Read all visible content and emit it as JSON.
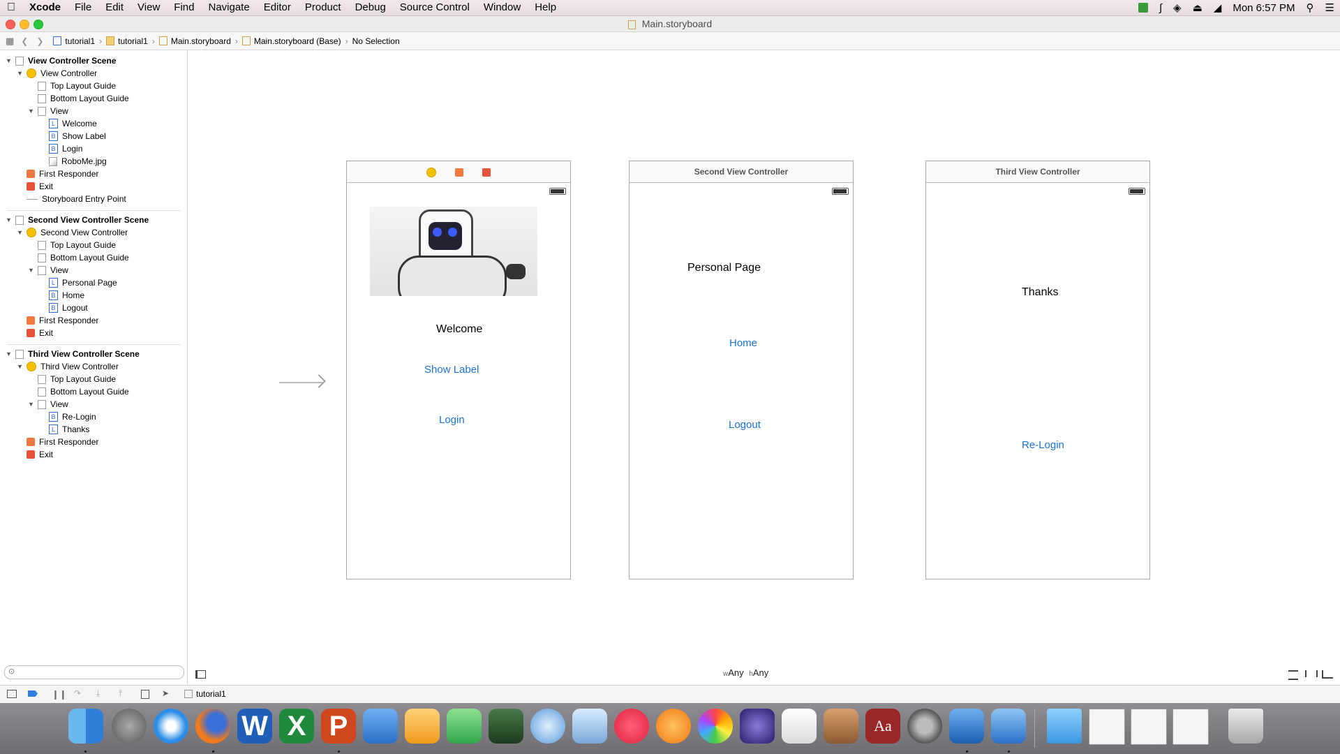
{
  "menubar": {
    "apple": "",
    "app": "Xcode",
    "items": [
      "File",
      "Edit",
      "View",
      "Find",
      "Navigate",
      "Editor",
      "Product",
      "Debug",
      "Source Control",
      "Window",
      "Help"
    ],
    "clock": "Mon 6:57 PM"
  },
  "window": {
    "title": "Main.storyboard"
  },
  "jumpbar": {
    "crumbs": [
      "tutorial1",
      "tutorial1",
      "Main.storyboard",
      "Main.storyboard (Base)",
      "No Selection"
    ]
  },
  "outline": {
    "scene1": {
      "title": "View Controller Scene",
      "controller": "View Controller",
      "top_guide": "Top Layout Guide",
      "bottom_guide": "Bottom Layout Guide",
      "view": "View",
      "children": [
        "Welcome",
        "Show Label",
        "Login",
        "RoboMe.jpg"
      ],
      "first_responder": "First Responder",
      "exit": "Exit",
      "entry": "Storyboard Entry Point"
    },
    "scene2": {
      "title": "Second View Controller Scene",
      "controller": "Second View Controller",
      "top_guide": "Top Layout Guide",
      "bottom_guide": "Bottom Layout Guide",
      "view": "View",
      "children": [
        "Personal Page",
        "Home",
        "Logout"
      ],
      "first_responder": "First Responder",
      "exit": "Exit"
    },
    "scene3": {
      "title": "Third View Controller Scene",
      "controller": "Third View Controller",
      "top_guide": "Top Layout Guide",
      "bottom_guide": "Bottom Layout Guide",
      "view": "View",
      "children": [
        "Re-Login",
        "Thanks"
      ],
      "first_responder": "First Responder",
      "exit": "Exit"
    }
  },
  "canvas": {
    "vc1": {
      "welcome": "Welcome",
      "show_label": "Show Label",
      "login": "Login"
    },
    "vc2": {
      "title": "Second View Controller",
      "personal": "Personal Page",
      "home": "Home",
      "logout": "Logout"
    },
    "vc3": {
      "title": "Third View Controller",
      "thanks": "Thanks",
      "relogin": "Re-Login"
    },
    "size_class": {
      "w_prefix": "w",
      "w": "Any",
      "h_prefix": "h",
      "h": "Any"
    }
  },
  "debugbar": {
    "target": "tutorial1"
  },
  "colors": {
    "link": "#1a73d9",
    "vc_icon": "#f2c200",
    "responder": "#f07a3e",
    "exit": "#e4523a"
  }
}
